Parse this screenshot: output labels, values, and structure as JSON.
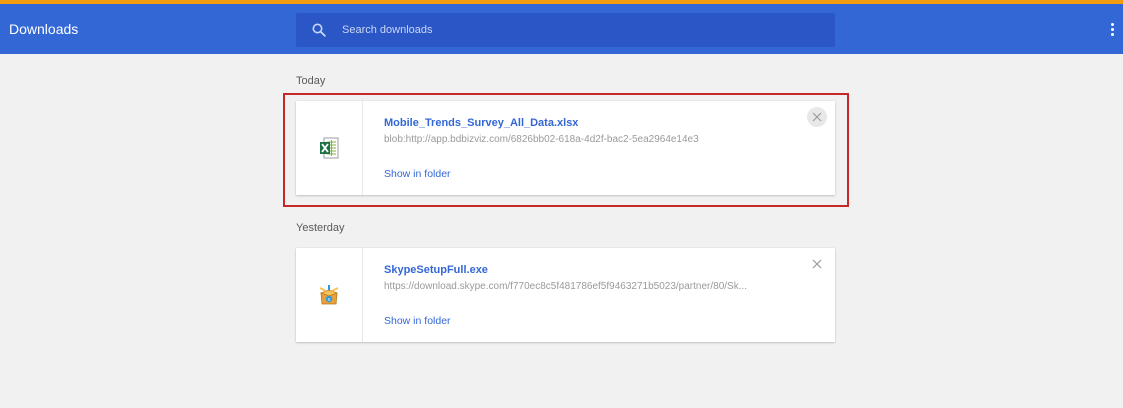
{
  "header": {
    "title": "Downloads",
    "search_placeholder": "Search downloads",
    "menu_icon": "more-vert-icon"
  },
  "colors": {
    "toolbar": "#3367d6",
    "search_box": "#2a56c6",
    "link": "#3367d6",
    "highlight": "#c62828",
    "accent": "#f39c12"
  },
  "sections": [
    {
      "heading": "Today",
      "items": [
        {
          "file_name": "Mobile_Trends_Survey_All_Data.xlsx",
          "url": "blob:http://app.bdbizviz.com/6826bb02-618a-4d2f-bac2-5ea2964e14e3",
          "action": "Show in folder",
          "icon": "excel-file-icon"
        }
      ]
    },
    {
      "heading": "Yesterday",
      "items": [
        {
          "file_name": "SkypeSetupFull.exe",
          "url": "https://download.skype.com/f770ec8c5f481786ef5f9463271b5023/partner/80/Sk...",
          "action": "Show in folder",
          "icon": "installer-icon"
        }
      ]
    }
  ]
}
